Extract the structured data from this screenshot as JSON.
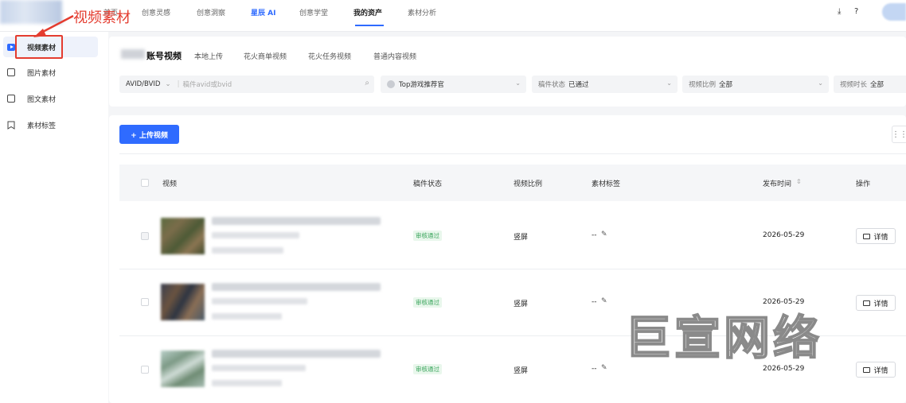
{
  "topnav": {
    "items": [
      "首页",
      "创意灵感",
      "创意洞察",
      "星辰 AI",
      "创意学堂",
      "我的资产",
      "素材分析"
    ],
    "active": "我的资产",
    "icons": [
      "download-icon",
      "help-icon"
    ]
  },
  "sidebar": {
    "items": [
      {
        "label": "视频素材",
        "icon": "video-icon",
        "active": true
      },
      {
        "label": "图片素材",
        "icon": "image-icon"
      },
      {
        "label": "图文素材",
        "icon": "document-icon"
      },
      {
        "label": "素材标签",
        "icon": "bookmark-icon"
      }
    ]
  },
  "annotation": {
    "text": "视频素材",
    "color": "#e43c2f"
  },
  "tabs": {
    "account": "账号视频",
    "items": [
      "本地上传",
      "花火商单视频",
      "花火任务视频",
      "普通内容视频"
    ]
  },
  "filters": {
    "id_type": "AVID/BVID",
    "search_placeholder": "稿件avid或bvid",
    "partition": "Top游戏推荐官",
    "status_label": "稿件状态",
    "status_value": "已通过",
    "ratio_label": "视频比例",
    "ratio_value": "全部",
    "duration_label": "视频时长",
    "duration_value": "全部"
  },
  "toolbar": {
    "upload_label": "+ 上传视频"
  },
  "table": {
    "headers": {
      "video": "视频",
      "status": "稿件状态",
      "ratio": "视频比例",
      "tags": "素材标签",
      "publish_time": "发布时间",
      "actions": "操作"
    },
    "rows": [
      {
        "status": "审核通过",
        "ratio": "竖屏",
        "tags": "--",
        "date": "2026-05-29",
        "action": "详情"
      },
      {
        "status": "审核通过",
        "ratio": "竖屏",
        "tags": "--",
        "date": "2026-05-29",
        "action": "详情"
      },
      {
        "status": "审核通过",
        "ratio": "竖屏",
        "tags": "--",
        "date": "2026-05-29",
        "action": "详情"
      }
    ]
  },
  "watermark": "巨宣网络",
  "colors": {
    "accent": "#2f6bff",
    "annotation": "#e43c2f",
    "status_green": "#3aa55c"
  }
}
